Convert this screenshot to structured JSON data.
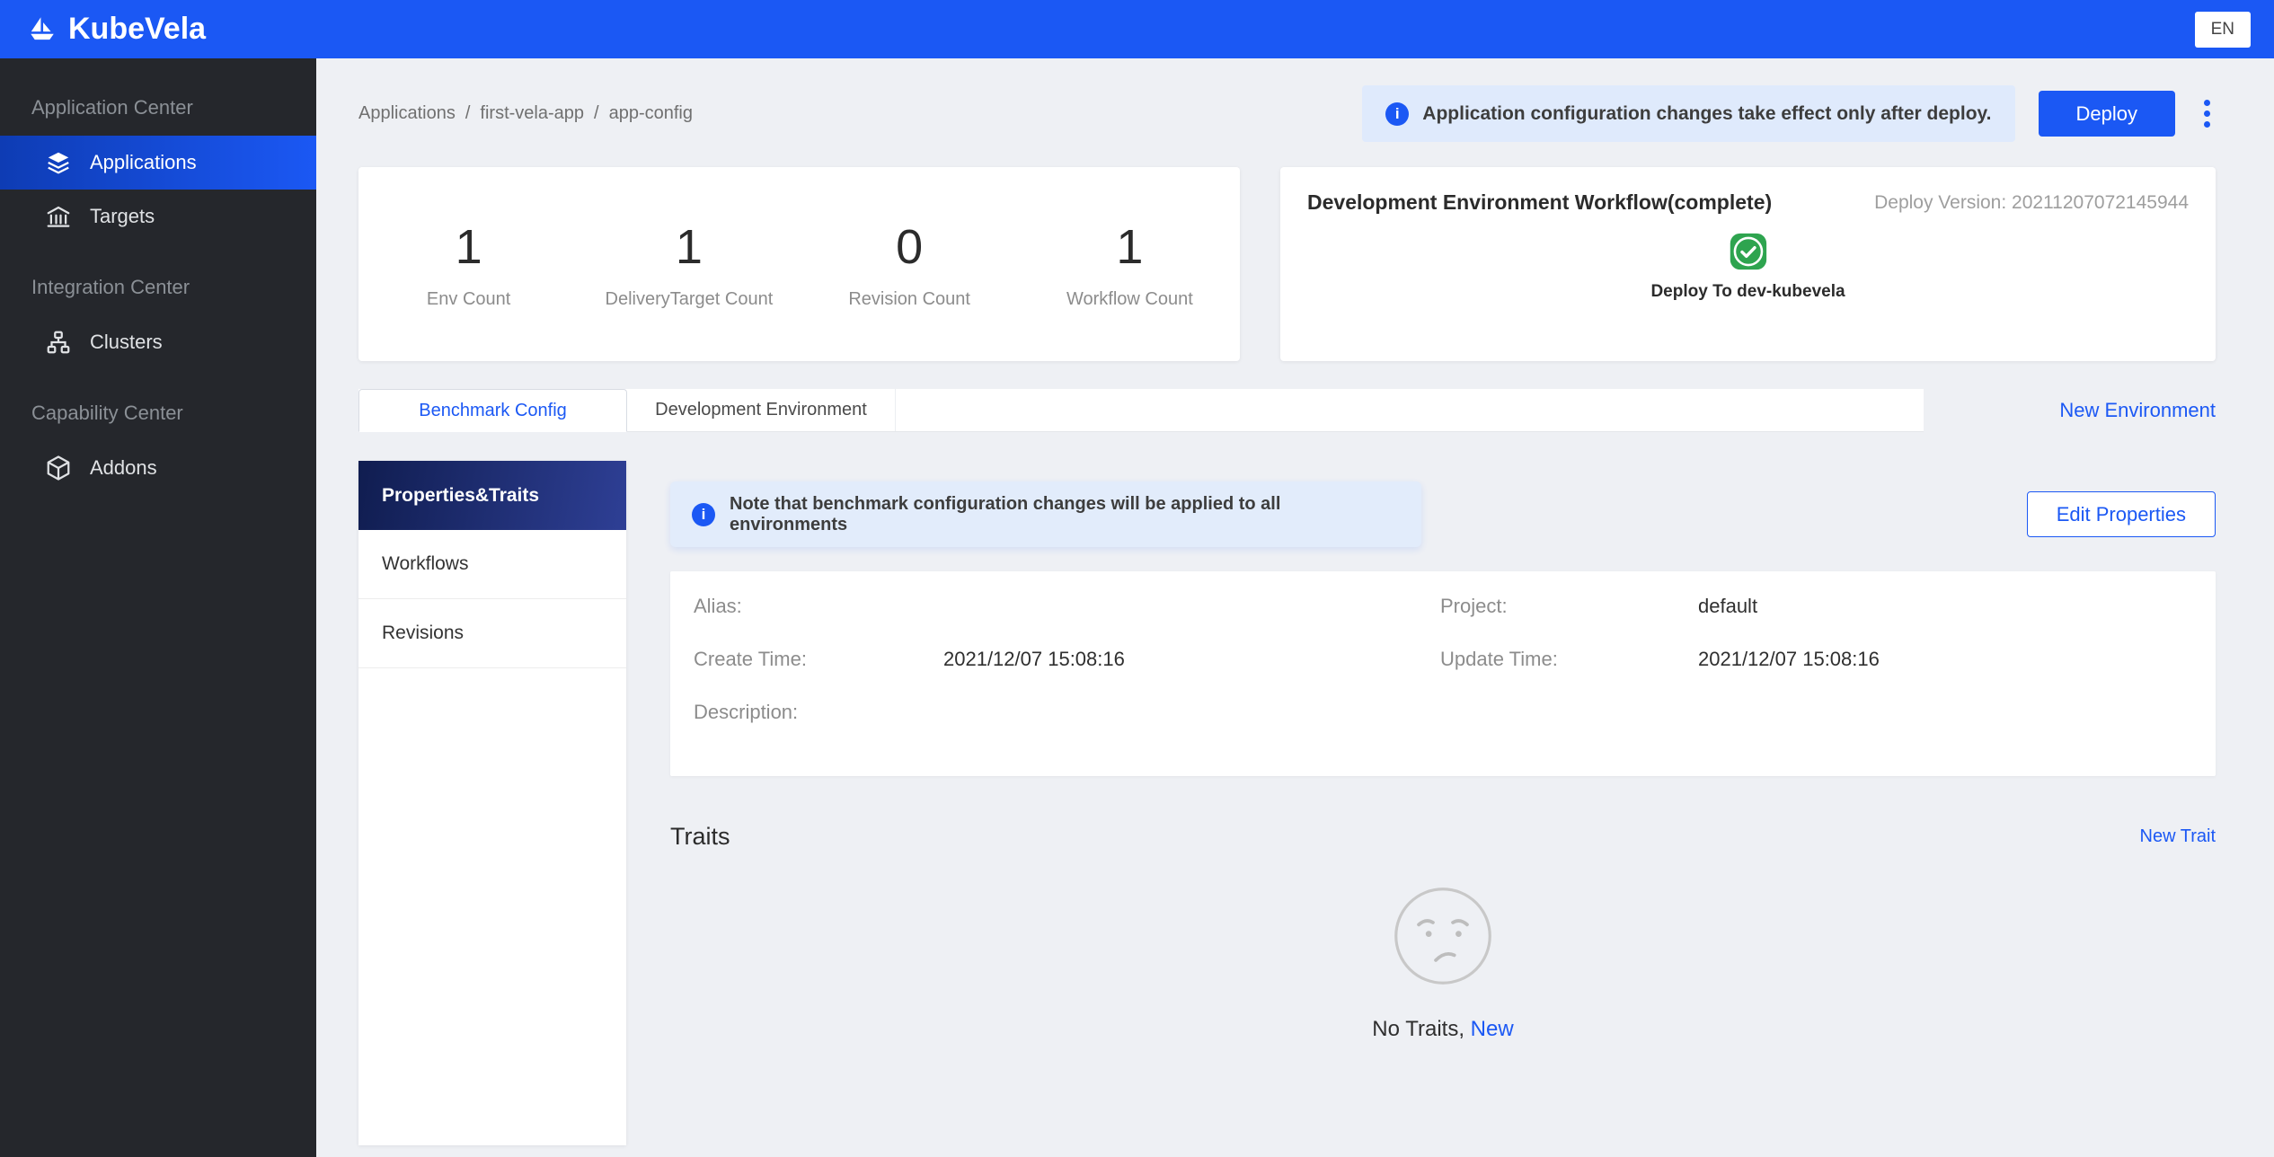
{
  "topbar": {
    "brand": "KubeVela",
    "lang": "EN"
  },
  "sidebar": {
    "sections": [
      {
        "title": "Application Center",
        "items": [
          {
            "label": "Applications",
            "icon": "layers-icon",
            "active": true
          },
          {
            "label": "Targets",
            "icon": "targets-icon",
            "active": false
          }
        ]
      },
      {
        "title": "Integration Center",
        "items": [
          {
            "label": "Clusters",
            "icon": "clusters-icon",
            "active": false
          }
        ]
      },
      {
        "title": "Capability Center",
        "items": [
          {
            "label": "Addons",
            "icon": "addons-icon",
            "active": false
          }
        ]
      }
    ]
  },
  "breadcrumb": {
    "items": [
      "Applications",
      "first-vela-app",
      "app-config"
    ],
    "separator": "/"
  },
  "header": {
    "alert": "Application configuration changes take effect only after deploy.",
    "deploy_label": "Deploy"
  },
  "stats": [
    {
      "value": "1",
      "label": "Env Count"
    },
    {
      "value": "1",
      "label": "DeliveryTarget Count"
    },
    {
      "value": "0",
      "label": "Revision Count"
    },
    {
      "value": "1",
      "label": "Workflow Count"
    }
  ],
  "workflow": {
    "title": "Development Environment Workflow(complete)",
    "deploy_version": "Deploy Version: 20211207072145944",
    "step_label": "Deploy To dev-kubevela",
    "step_status_icon": "check-success-icon"
  },
  "tabs": [
    {
      "label": "Benchmark Config",
      "active": true
    },
    {
      "label": "Development Environment",
      "active": false
    }
  ],
  "new_environment_label": "New Environment",
  "subnav": [
    {
      "label": "Properties&Traits",
      "active": true
    },
    {
      "label": "Workflows",
      "active": false
    },
    {
      "label": "Revisions",
      "active": false
    }
  ],
  "benchmark": {
    "note": "Note that benchmark configuration changes will be applied to all environments",
    "edit_button": "Edit Properties",
    "fields": {
      "alias": {
        "label": "Alias:",
        "value": ""
      },
      "project": {
        "label": "Project:",
        "value": "default"
      },
      "create_time": {
        "label": "Create Time:",
        "value": "2021/12/07 15:08:16"
      },
      "update_time": {
        "label": "Update Time:",
        "value": "2021/12/07 15:08:16"
      },
      "description": {
        "label": "Description:",
        "value": ""
      }
    }
  },
  "traits": {
    "title": "Traits",
    "new_label": "New Trait",
    "empty_prefix": "No Traits,",
    "empty_link": "New"
  },
  "colors": {
    "primary": "#1b58f4",
    "sidebar_bg": "#25272c",
    "page_bg": "#eef0f4",
    "alert_bg": "#dfeafc",
    "success": "#2ea44f",
    "subnav_active_start": "#101d50",
    "subnav_active_end": "#2e3f95"
  }
}
